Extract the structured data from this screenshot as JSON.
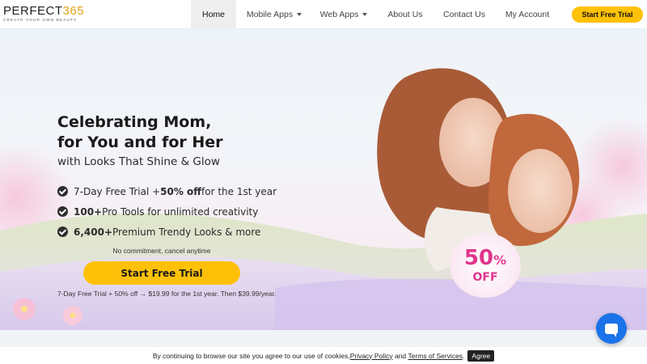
{
  "logo": {
    "brand_text": "PERFECT",
    "brand_num": "365",
    "tagline": "CREATE YOUR OWN BEAUTY"
  },
  "nav": {
    "items": [
      {
        "label": "Home",
        "active": true
      },
      {
        "label": "Mobile Apps",
        "dropdown": true
      },
      {
        "label": "Web Apps",
        "dropdown": true
      },
      {
        "label": "About Us"
      },
      {
        "label": "Contact Us"
      },
      {
        "label": "My Account"
      }
    ],
    "cta": "Start Free Trial"
  },
  "hero": {
    "headline_line1": "Celebrating Mom,",
    "headline_line2": "for You and for Her",
    "subhead": "with Looks That Shine & Glow",
    "bullets": [
      {
        "pre": "7-Day Free Trial + ",
        "bold": "50% off",
        "post": " for the 1st year"
      },
      {
        "pre": "",
        "bold": "100+",
        "post": " Pro Tools for unlimited creativity"
      },
      {
        "pre": "",
        "bold": "6,400+",
        "post": " Premium Trendy Looks & more"
      }
    ],
    "no_commitment": "No commitment, cancel anytime",
    "cta": "Start Free Trial",
    "fine_print": "7-Day Free Trial + 50% off → $19.99 for the 1st year. Then $39.99/year.",
    "badge": {
      "percent": "50",
      "percent_sign": "%",
      "off": "OFF"
    }
  },
  "cookie": {
    "text_before": "By continuing to browse our site you agree to our use of cookies, ",
    "privacy_link": "Privacy Policy",
    "and": " and ",
    "terms_link": "Terms of Services",
    "period": ".",
    "agree": "Agree"
  },
  "colors": {
    "accent": "#ffc107",
    "badge_pink": "#e0358d",
    "chat_blue": "#1a73e8"
  },
  "icons": [
    "check-icon",
    "chevron-down-icon",
    "chat-icon"
  ]
}
